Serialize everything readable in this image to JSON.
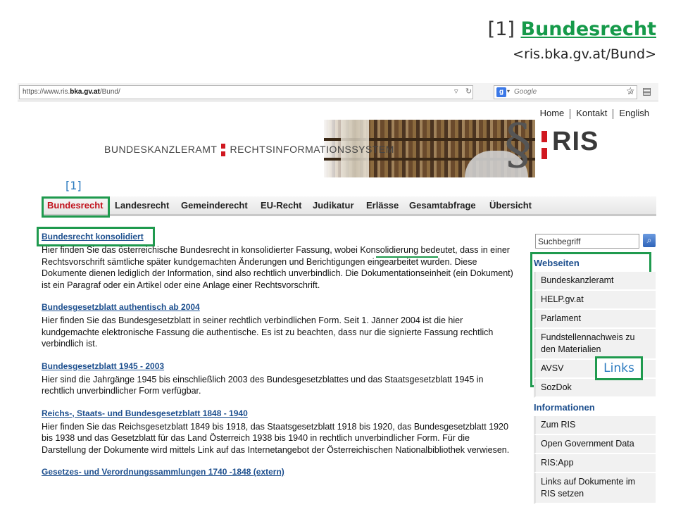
{
  "slide": {
    "ref": "[1]",
    "title_link": "Bundesrecht",
    "subtitle": "<ris.bka.gv.at/Bund>"
  },
  "browser": {
    "url_prefix": "https://www.ris.",
    "url_domain": "bka.gv.at",
    "url_path": "/Bund/",
    "search_engine": "Google",
    "icons": [
      "star-icon",
      "clipboard-icon",
      "search-icon",
      "reload-icon"
    ]
  },
  "topnav": {
    "home": "Home",
    "kontakt": "Kontakt",
    "english": "English"
  },
  "banner": {
    "org_left": "BUNDESKANZLERAMT",
    "org_right": "RECHTSINFORMATIONSSYSTEM",
    "para": "§",
    "ris": "RIS"
  },
  "tabs": [
    {
      "label": "Bundesrecht",
      "active": true
    },
    {
      "label": "Landesrecht",
      "active": false
    },
    {
      "label": "Gemeinderecht",
      "active": false
    },
    {
      "label": "EU-Recht",
      "active": false
    },
    {
      "label": "Judikatur",
      "active": false
    },
    {
      "label": "Erlässe",
      "active": false
    },
    {
      "label": "Gesamtabfrage",
      "active": false
    },
    {
      "label": "Übersicht",
      "active": false
    }
  ],
  "annotations": {
    "tab_ref": "[1]",
    "links_label": "Links",
    "color": "#1f9a4e"
  },
  "sections": [
    {
      "title": "Bundesrecht konsolidiert",
      "text": "Hier finden Sie das österreichische Bundesrecht in konsolidierter Fassung, wobei Konsolidierung bedeutet, dass in einer Rechtsvorschrift sämtliche später kundgemachten Änderungen und Berichtigungen eingearbeitet wurden. Diese Dokumente dienen lediglich der Information, sind also rechtlich unverbindlich. Die Dokumentationseinheit (ein Dokument) ist ein Paragraf oder ein Artikel oder eine Anlage einer Rechtsvorschrift."
    },
    {
      "title": "Bundesgesetzblatt authentisch ab 2004",
      "text": "Hier finden Sie das Bundesgesetzblatt in seiner rechtlich verbindlichen Form. Seit 1. Jänner 2004 ist die hier kundgemachte elektronische Fassung die authentische. Es ist zu beachten, dass nur die signierte Fassung rechtlich verbindlich ist."
    },
    {
      "title": "Bundesgesetzblatt 1945 - 2003",
      "text": "Hier sind die Jahrgänge 1945 bis einschließlich 2003 des Bundesgesetzblattes und das Staatsgesetzblatt 1945 in rechtlich unverbindlicher Form verfügbar."
    },
    {
      "title": "Reichs-, Staats- und Bundesgesetzblatt 1848 - 1940",
      "text": "Hier finden Sie das Reichsgesetzblatt 1849 bis 1918, das Staatsgesetzblatt 1918 bis 1920, das Bundesgesetzblatt 1920 bis 1938 und das Gesetzblatt für das Land Österreich 1938 bis 1940 in rechtlich unverbindlicher Form. Für die Darstellung der Dokumente wird mittels Link auf das Internetangebot der Österreichischen Nationalbibliothek verwiesen."
    },
    {
      "title": "Gesetzes- und Verordnungssammlungen 1740 -1848 (extern)",
      "text": ""
    }
  ],
  "sidebar": {
    "search_placeholder": "Suchbegriff",
    "webseiten_title": "Webseiten",
    "webseiten": [
      "Bundeskanzleramt",
      "HELP.gv.at",
      "Parlament",
      "Fundstellennachweis zu den Materialien",
      "AVSV",
      "SozDok"
    ],
    "informationen_title": "Informationen",
    "informationen": [
      "Zum RIS",
      "Open Government Data",
      "RIS:App",
      "Links auf Dokumente im RIS setzen"
    ]
  }
}
